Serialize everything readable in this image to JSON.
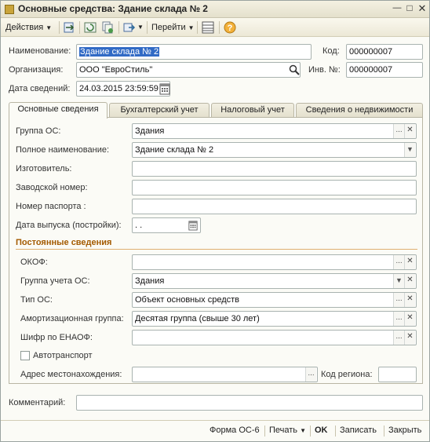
{
  "window": {
    "title": "Основные средства: Здание склада № 2"
  },
  "toolbar": {
    "actions_label": "Действия",
    "goto_label": "Перейти"
  },
  "header": {
    "name_label": "Наименование:",
    "name_value": "Здание склада № 2",
    "code_label": "Код:",
    "code_value": "000000007",
    "org_label": "Организация:",
    "org_value": "ООО \"ЕвроСтиль\"",
    "inv_label": "Инв. №:",
    "inv_value": "000000007",
    "date_label": "Дата сведений:",
    "date_value": "24.03.2015 23:59:59"
  },
  "tabs": [
    "Основные сведения",
    "Бухгалтерский учет",
    "Налоговый учет",
    "Сведения о недвижимости"
  ],
  "main": {
    "group_label": "Группа ОС:",
    "group_value": "Здания",
    "fullname_label": "Полное наименование:",
    "fullname_value": "Здание склада № 2",
    "maker_label": "Изготовитель:",
    "maker_value": "",
    "serial_label": "Заводской номер:",
    "serial_value": "",
    "passport_label": "Номер паспорта :",
    "passport_value": "",
    "release_label": "Дата выпуска (постройки):",
    "release_value": " .  .",
    "section_title": "Постоянные сведения",
    "okof_label": "ОКОФ:",
    "okof_value": "",
    "acc_group_label": "Группа учета ОС:",
    "acc_group_value": "Здания",
    "type_label": "Тип ОС:",
    "type_value": "Объект основных средств",
    "amort_label": "Амортизационная группа:",
    "amort_value": "Десятая группа (свыше 30 лет)",
    "enaof_label": "Шифр по ЕНАОФ:",
    "enaof_value": "",
    "auto_label": "Автотранспорт",
    "address_label": "Адрес местонахождения:",
    "address_value": "",
    "region_label": "Код региона:",
    "region_value": ""
  },
  "comment": {
    "label": "Комментарий:",
    "value": ""
  },
  "footer": {
    "form_label": "Форма ОС-6",
    "print_label": "Печать",
    "ok_label": "OK",
    "save_label": "Записать",
    "close_label": "Закрыть"
  },
  "colors": {
    "accent": "#316ac5",
    "section": "#a35a00"
  }
}
